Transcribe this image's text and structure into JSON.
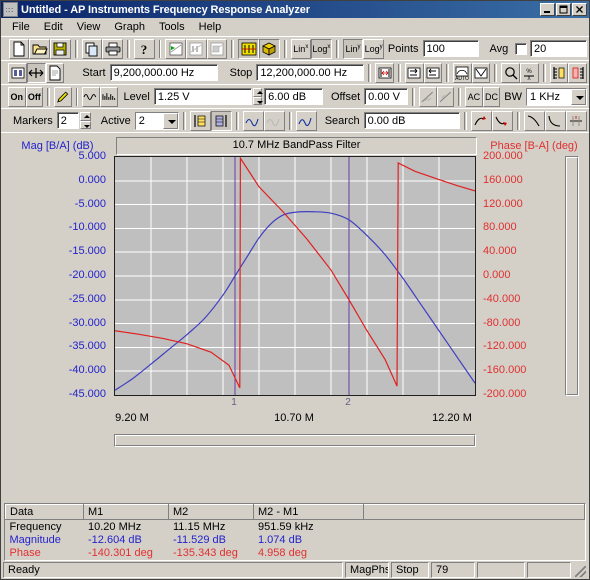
{
  "window": {
    "title": "Untitled - AP Instruments Frequency Response Analyzer",
    "minimize_label": "_",
    "maximize_label": "❐",
    "close_label": "✕"
  },
  "menu": [
    {
      "label": "File"
    },
    {
      "label": "Edit"
    },
    {
      "label": "View"
    },
    {
      "label": "Graph"
    },
    {
      "label": "Tools"
    },
    {
      "label": "Help"
    }
  ],
  "toolbar1": {
    "buttons": [
      {
        "name": "new-file-button",
        "icon": "new-document-icon"
      },
      {
        "name": "open-file-button",
        "icon": "open-folder-icon"
      },
      {
        "name": "save-file-button",
        "icon": "floppy-disk-icon"
      },
      {
        "name": "copy-button",
        "icon": "copy-icon"
      },
      {
        "name": "print-button",
        "icon": "printer-icon"
      },
      {
        "name": "help-button",
        "icon": "question-mark-icon"
      },
      {
        "name": "sweep-start-button",
        "icon": "sweep-run-icon"
      },
      {
        "name": "sweep-pause-button",
        "icon": "sweep-pause-icon"
      },
      {
        "name": "sweep-stop-button",
        "icon": "sweep-stop-icon"
      },
      {
        "name": "cursor-mode-button",
        "icon": "cursor-bars-icon"
      },
      {
        "name": "layers-button",
        "icon": "stacked-layers-icon"
      }
    ],
    "lin_x_label": "Lin",
    "lin_x_sup": "x",
    "log_x_label": "Log",
    "log_x_sup": "x",
    "lin_y_label": "Lin",
    "lin_y_sup": "y",
    "log_y_label": "Log",
    "log_y_sup": "y",
    "points_label": "Points",
    "points_value": "100",
    "avg_label": "Avg",
    "avg_value": "20"
  },
  "toolbar2": {
    "start_label": "Start",
    "start_value": "9,200,000.00 Hz",
    "stop_label": "Stop",
    "stop_value": "12,200,000.00 Hz",
    "buttons": [
      {
        "name": "view-split-button",
        "icon": "split-view-icon"
      },
      {
        "name": "span-button",
        "icon": "span-arrows-icon"
      },
      {
        "name": "notes-button",
        "icon": "document-icon"
      },
      {
        "name": "center-span-button",
        "icon": "center-span-icon"
      },
      {
        "name": "zoom-in-x-button",
        "icon": "zoom-in-x-icon"
      },
      {
        "name": "zoom-out-x-button",
        "icon": "zoom-out-x-icon"
      },
      {
        "name": "autoscale-button",
        "icon": "autoscale-icon"
      },
      {
        "name": "fit-button",
        "icon": "fit-window-icon"
      },
      {
        "name": "magnifier-button",
        "icon": "magnifier-icon"
      },
      {
        "name": "percent-button",
        "icon": "percent-icon"
      },
      {
        "name": "scale-mag-button",
        "icon": "scale-magnitude-icon"
      },
      {
        "name": "scale-phase-button",
        "icon": "scale-phase-icon"
      }
    ]
  },
  "toolbar3": {
    "on_label": "On",
    "off_label": "Off",
    "level_label": "Level",
    "level_value": "1.25 V",
    "level_db_value": "6.00 dB",
    "offset_label": "Offset",
    "offset_value": "0.00 V",
    "ac_label": "AC",
    "dc_label": "DC",
    "bw_label": "BW",
    "bw_value": "1 KHz",
    "buttons": [
      {
        "name": "source-waveform-button",
        "icon": "sine-wave-icon"
      },
      {
        "name": "source-noise-button",
        "icon": "noise-wave-icon"
      },
      {
        "name": "source-pencil-button",
        "icon": "pencil-icon"
      },
      {
        "name": "channel-a-button",
        "icon": "slope-a-icon"
      },
      {
        "name": "channel-b-button",
        "icon": "slope-b-icon"
      }
    ]
  },
  "toolbar4": {
    "markers_label": "Markers",
    "markers_value": "2",
    "active_label": "Active",
    "active_value": "2",
    "search_label": "Search",
    "search_value": "0.00 dB",
    "buttons": [
      {
        "name": "marker-left-button",
        "icon": "marker-left-icon"
      },
      {
        "name": "marker-right-button",
        "icon": "marker-right-icon"
      },
      {
        "name": "trace-smooth-button",
        "icon": "smooth-trace-icon"
      },
      {
        "name": "trace-raw-button",
        "icon": "raw-trace-icon"
      },
      {
        "name": "trace-overlay-button",
        "icon": "overlay-trace-icon"
      },
      {
        "name": "search-peak-up-button",
        "icon": "search-peak-up-icon"
      },
      {
        "name": "search-peak-down-button",
        "icon": "search-peak-down-icon"
      },
      {
        "name": "search-fall-button",
        "icon": "search-falling-icon"
      },
      {
        "name": "search-rise-button",
        "icon": "search-rising-icon"
      },
      {
        "name": "search-delta-button",
        "icon": "search-delta-icon"
      }
    ]
  },
  "chart_data": {
    "type": "line",
    "title": "10.7 MHz BandPass Filter",
    "xlabel": "",
    "ylabel": "Mag [B/A] (dB)",
    "ylabel_right": "Phase [B-A] (deg)",
    "grid": true,
    "legend": "none",
    "x_unit": "Hz",
    "xlim": [
      9200000,
      12200000
    ],
    "x_tick_labels": [
      "9.20 M",
      "10.70 M",
      "12.20 M"
    ],
    "x_tick_values": [
      9200000,
      10700000,
      12200000
    ],
    "ylim": [
      -45,
      5
    ],
    "y_ticks": [
      5.0,
      0.0,
      -5.0,
      -10.0,
      -15.0,
      -20.0,
      -25.0,
      -30.0,
      -35.0,
      -40.0,
      -45.0
    ],
    "y_tick_labels": [
      "5.000",
      "0.000",
      "-5.000",
      "-10.000",
      "-15.000",
      "-20.000",
      "-25.000",
      "-30.000",
      "-35.000",
      "-40.000",
      "-45.000"
    ],
    "ylim_right": [
      -200,
      200
    ],
    "y_ticks_right": [
      200.0,
      160.0,
      120.0,
      80.0,
      40.0,
      0.0,
      -40.0,
      -80.0,
      -120.0,
      -160.0,
      -200.0
    ],
    "y_tick_labels_right": [
      "200.000",
      "160.000",
      "120.000",
      "80.000",
      "40.000",
      "0.000",
      "-40.000",
      "-80.000",
      "-120.000",
      "-160.000",
      "-200.000"
    ],
    "markers": [
      {
        "label": "1",
        "frequency": 10200000,
        "x_frac": 0.3333
      },
      {
        "label": "2",
        "frequency": 11150000,
        "x_frac": 0.65
      }
    ],
    "series": [
      {
        "name": "Magnitude",
        "axis": "left",
        "color": "#4040c0",
        "unit": "dB",
        "points": [
          [
            9200000,
            -44.0
          ],
          [
            9350000,
            -41.5
          ],
          [
            9500000,
            -38.5
          ],
          [
            9650000,
            -35.4
          ],
          [
            9800000,
            -32.3
          ],
          [
            9950000,
            -28.8
          ],
          [
            10100000,
            -24.0
          ],
          [
            10200000,
            -20.0
          ],
          [
            10300000,
            -16.0
          ],
          [
            10400000,
            -12.0
          ],
          [
            10500000,
            -9.0
          ],
          [
            10600000,
            -7.2
          ],
          [
            10700000,
            -6.6
          ],
          [
            10850000,
            -6.5
          ],
          [
            11000000,
            -6.8
          ],
          [
            11150000,
            -8.2
          ],
          [
            11300000,
            -11.5
          ],
          [
            11450000,
            -15.5
          ],
          [
            11600000,
            -20.5
          ],
          [
            11750000,
            -26.0
          ],
          [
            11900000,
            -31.5
          ],
          [
            12050000,
            -37.0
          ],
          [
            12200000,
            -42.5
          ]
        ]
      },
      {
        "name": "Phase",
        "axis": "right",
        "color": "#e02020",
        "unit": "deg",
        "points": [
          [
            9200000,
            -92.0
          ],
          [
            9400000,
            -98.0
          ],
          [
            9600000,
            -105.0
          ],
          [
            9800000,
            -114.0
          ],
          [
            10000000,
            -128.0
          ],
          [
            10150000,
            -150.0
          ],
          [
            10240000,
            -188.0
          ],
          [
            10245000,
            198.0
          ],
          [
            10400000,
            150.0
          ],
          [
            10600000,
            108.0
          ],
          [
            10800000,
            62.0
          ],
          [
            11000000,
            10.0
          ],
          [
            11150000,
            -40.0
          ],
          [
            11300000,
            -92.0
          ],
          [
            11450000,
            -140.0
          ],
          [
            11550000,
            -185.0
          ],
          [
            11560000,
            190.0
          ],
          [
            11700000,
            176.0
          ],
          [
            11900000,
            162.0
          ],
          [
            12050000,
            152.0
          ],
          [
            12200000,
            143.0
          ]
        ]
      }
    ]
  },
  "data_table": {
    "headers": [
      "Data",
      "M1",
      "M2",
      "M2 - M1",
      ""
    ],
    "rows": [
      {
        "label": "Frequency",
        "m1": "10.20 MHz",
        "m2": "11.15 MHz",
        "delta": "951.59 kHz"
      },
      {
        "label": "Magnitude",
        "m1": "-12.604 dB",
        "m2": "-11.529 dB",
        "delta": "1.074 dB"
      },
      {
        "label": "Phase",
        "m1": "-140.301 deg",
        "m2": "-135.343 deg",
        "delta": "4.958 deg"
      }
    ]
  },
  "statusbar": {
    "message": "Ready",
    "mode": "MagPhs",
    "state": "Stop",
    "count": "79",
    "cell4": "",
    "cell5": ""
  }
}
